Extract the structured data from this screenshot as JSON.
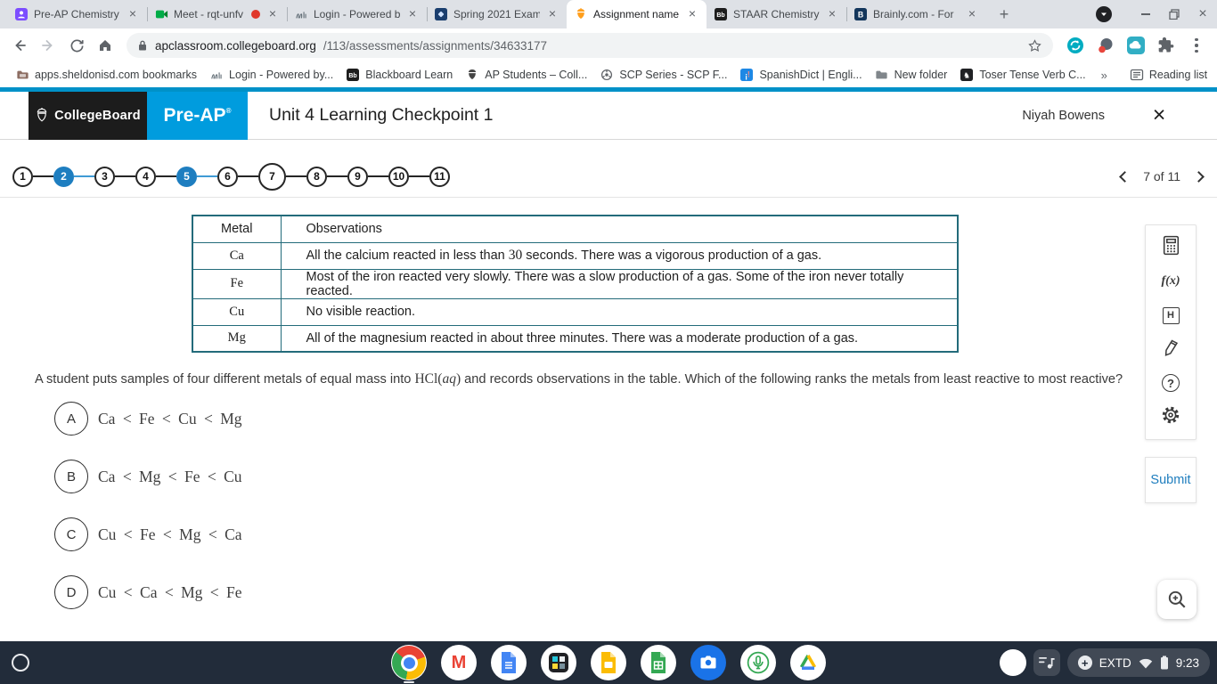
{
  "browser": {
    "tabs": [
      {
        "title": "Pre-AP Chemistry",
        "icon": "person"
      },
      {
        "title": "Meet - rqt-unfv",
        "icon": "meet",
        "recording": true
      },
      {
        "title": "Login - Powered b",
        "icon": "script"
      },
      {
        "title": "Spring 2021 Exam",
        "icon": "exam"
      },
      {
        "title": "Assignment name",
        "icon": "acorn",
        "active": true
      },
      {
        "title": "STAAR Chemistry",
        "icon": "blackboard"
      },
      {
        "title": "Brainly.com - For",
        "icon": "brainly"
      }
    ],
    "tab_close": "×",
    "new_tab": "+",
    "window_controls": {
      "close": "×"
    },
    "address": {
      "host": "apclassroom.collegeboard.org",
      "path": "/113/assessments/assignments/34633177"
    },
    "bookmarks": [
      {
        "label": "apps.sheldonisd.com bookmarks",
        "icon": "folder-apps"
      },
      {
        "label": "Login - Powered by...",
        "icon": "script"
      },
      {
        "label": "Blackboard Learn",
        "icon": "blackboard"
      },
      {
        "label": "AP Students – Coll...",
        "icon": "acorn-dark"
      },
      {
        "label": "SCP Series - SCP F...",
        "icon": "scp"
      },
      {
        "label": "SpanishDict | Engli...",
        "icon": "spanishdict"
      },
      {
        "label": "New folder",
        "icon": "folder"
      },
      {
        "label": "Toser Tense Verb C...",
        "icon": "toser"
      }
    ],
    "bookmarks_overflow": "»",
    "reading_list": "Reading list"
  },
  "app_header": {
    "brand": "CollegeBoard",
    "program": "Pre-AP",
    "program_reg": "®",
    "title": "Unit 4 Learning Checkpoint 1",
    "user": "Niyah Bowens",
    "close": "×"
  },
  "question_nav": {
    "total": 11,
    "current": 7,
    "answered": [
      2,
      5
    ],
    "pager": "7 of 11"
  },
  "question": {
    "table": {
      "headers": [
        "Metal",
        "Observations"
      ],
      "rows": [
        {
          "metal": "Ca",
          "obs": [
            {
              "t": "All the calcium reacted in less than "
            },
            {
              "t": "30",
              "math": true
            },
            {
              "t": " seconds. There was a vigorous production of a gas."
            }
          ]
        },
        {
          "metal": "Fe",
          "obs": [
            {
              "t": "Most of the iron reacted very slowly. There was a slow production of a gas. Some of the iron never totally reacted."
            }
          ]
        },
        {
          "metal": "Cu",
          "obs": [
            {
              "t": "No visible reaction."
            }
          ]
        },
        {
          "metal": "Mg",
          "obs": [
            {
              "t": "All of the magnesium reacted in about three minutes. There was a moderate production of a gas."
            }
          ]
        }
      ]
    },
    "prompt": [
      {
        "t": "A student puts samples of four different metals of equal mass into "
      },
      {
        "t": "HCl(",
        "math": true
      },
      {
        "t": "aq",
        "math": true,
        "italic": true
      },
      {
        "t": ")",
        "math": true
      },
      {
        "t": " and records observations in the table. Which of the following ranks the metals from least reactive to most reactive?"
      }
    ],
    "options": [
      {
        "letter": "A",
        "text": "Ca < Fe < Cu < Mg"
      },
      {
        "letter": "B",
        "text": "Ca < Mg < Fe < Cu"
      },
      {
        "letter": "C",
        "text": "Cu < Fe < Mg < Ca"
      },
      {
        "letter": "D",
        "text": "Cu < Ca < Mg < Fe"
      }
    ]
  },
  "tools": {
    "items": [
      "calculator",
      "function",
      "periodic-table",
      "pen",
      "help",
      "settings"
    ],
    "glyphs": {
      "function": "f(x)",
      "periodic": "H",
      "help": "?"
    },
    "submit": "Submit"
  },
  "shelf": {
    "apps": [
      "chrome",
      "gmail",
      "docs",
      "capture",
      "slides",
      "sheets",
      "camera",
      "recorder",
      "drive"
    ],
    "active_app": "chrome",
    "status": {
      "plus": "+",
      "badge": "EXTD",
      "time": "9:23"
    }
  },
  "colors": {
    "accent_blue": "#1e7dbe",
    "preap_blue": "#009cde",
    "table_teal": "#236b7a",
    "shelf_bg": "#222c3a"
  }
}
